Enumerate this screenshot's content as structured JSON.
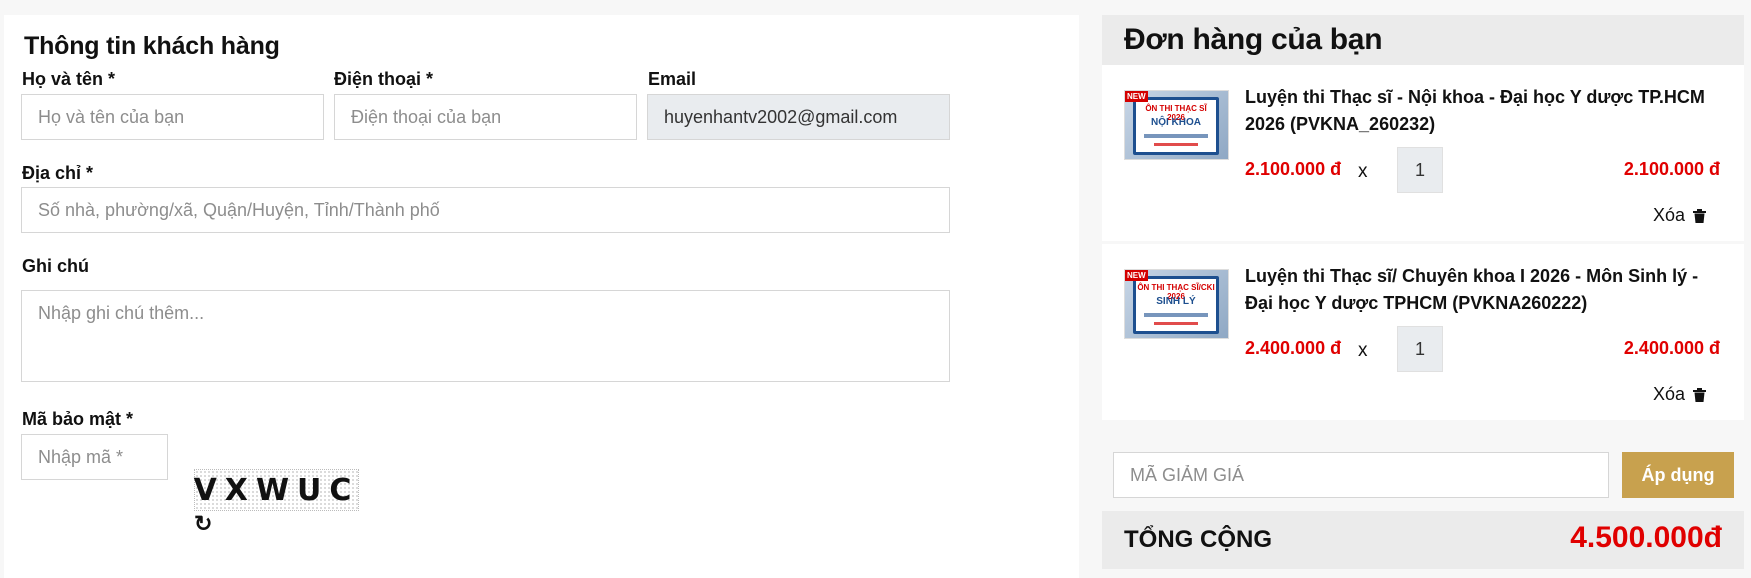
{
  "customer": {
    "title": "Thông tin khách hàng",
    "name_label": "Họ và tên *",
    "name_placeholder": "Họ và tên của bạn",
    "phone_label": "Điện thoại *",
    "phone_placeholder": "Điện thoại của bạn",
    "email_label": "Email",
    "email_value": "huyenhantv2002@gmail.com",
    "address_label": "Địa chỉ *",
    "address_placeholder": "Số nhà, phường/xã, Quận/Huyện, Tỉnh/Thành phố",
    "note_label": "Ghi chú",
    "note_placeholder": "Nhập ghi chú thêm...",
    "captcha_label": "Mã bảo mật *",
    "captcha_placeholder": "Nhập mã *",
    "captcha_text": "VXWUC",
    "refresh_icon": "refresh-icon"
  },
  "order": {
    "title": "Đơn hàng của bạn",
    "items": [
      {
        "name": "Luyện thi Thạc sĩ - Nội khoa - Đại học Y dược TP.HCM 2026 (PVKNA_260232)",
        "price": "2.100.000 đ",
        "times": "x",
        "quantity": "1",
        "line_total": "2.100.000 đ",
        "delete_label": "Xóa",
        "thumb": {
          "ribbon": "NEW",
          "line1": "ÔN THI THẠC SĨ 2026",
          "line2": "NỘI KHOA"
        }
      },
      {
        "name": "Luyện thi Thạc sĩ/ Chuyên khoa I 2026 - Môn Sinh lý - Đại học Y dược TPHCM (PVKNA260222)",
        "price": "2.400.000 đ",
        "times": "x",
        "quantity": "1",
        "line_total": "2.400.000 đ",
        "delete_label": "Xóa",
        "thumb": {
          "ribbon": "NEW",
          "line1": "ÔN THI THẠC SĨ/CKI 2026",
          "line2": "SINH LÝ"
        }
      }
    ],
    "coupon_placeholder": "MÃ GIẢM GIÁ",
    "apply_label": "Áp dụng",
    "total_label": "TỔNG CỘNG",
    "total_value": "4.500.000đ",
    "colors": {
      "price": "#e00000",
      "accent": "#c8a14e"
    }
  }
}
